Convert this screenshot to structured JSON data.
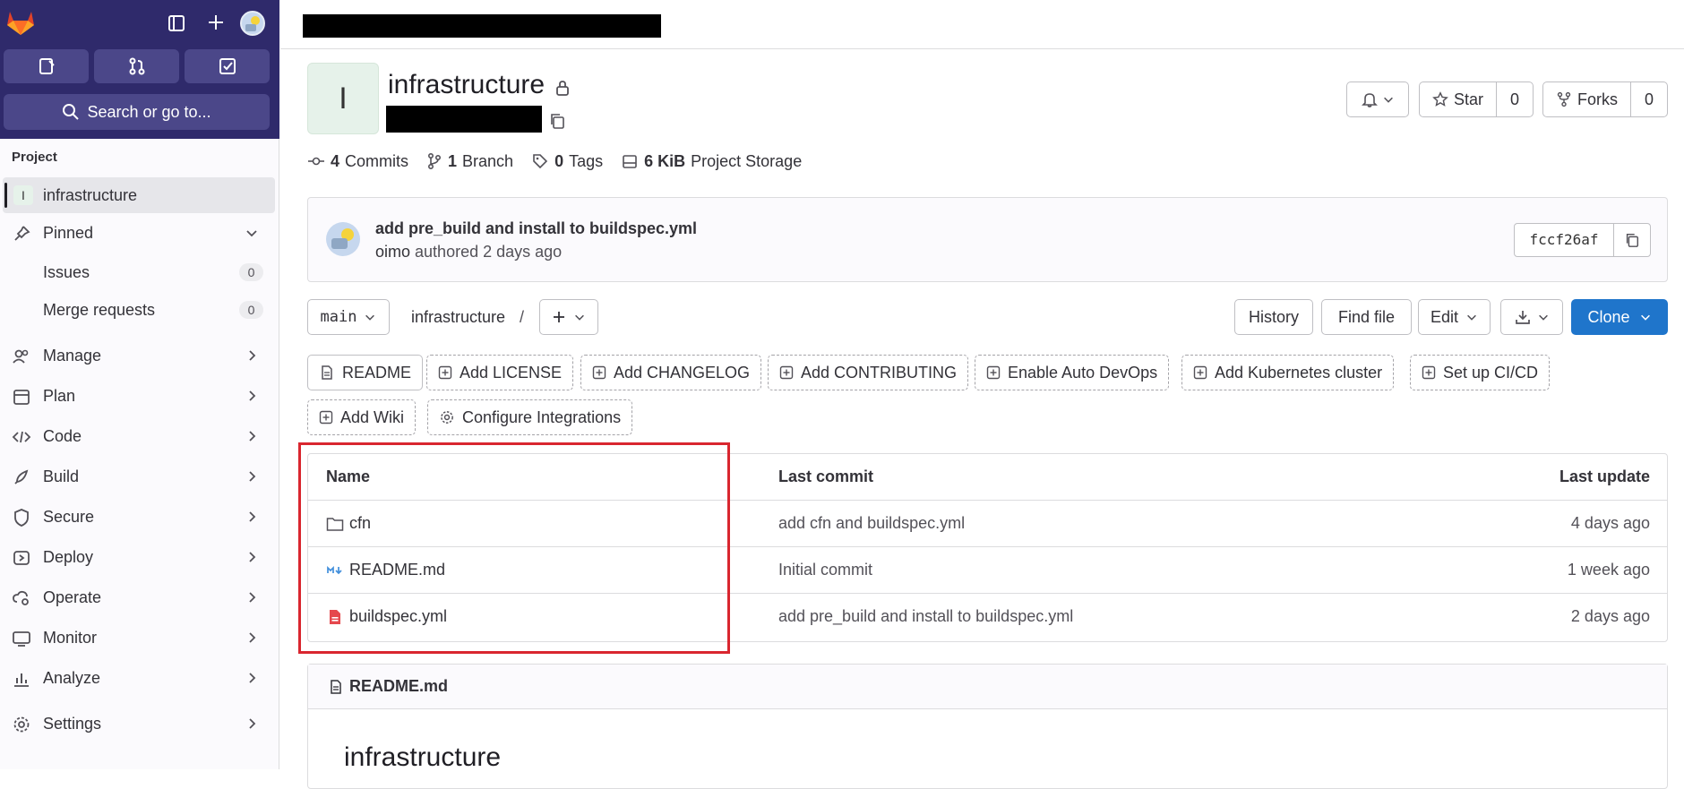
{
  "colors": {
    "sidebar_top": "#2f2a6b",
    "tile": "#4b4789",
    "primary": "#1f75cb",
    "highlight": "#d9262f"
  },
  "sidebar": {
    "search_label": "Search or go to...",
    "section_label": "Project",
    "project": {
      "avatar_letter": "I",
      "name": "infrastructure"
    },
    "pinned": {
      "label": "Pinned",
      "items": [
        {
          "label": "Issues",
          "count": "0"
        },
        {
          "label": "Merge requests",
          "count": "0"
        }
      ]
    },
    "nav": [
      {
        "label": "Manage",
        "icon": "users-icon"
      },
      {
        "label": "Plan",
        "icon": "calendar-icon"
      },
      {
        "label": "Code",
        "icon": "code-icon"
      },
      {
        "label": "Build",
        "icon": "rocket-icon"
      },
      {
        "label": "Secure",
        "icon": "shield-icon"
      },
      {
        "label": "Deploy",
        "icon": "deploy-icon"
      },
      {
        "label": "Operate",
        "icon": "cloud-gear-icon"
      },
      {
        "label": "Monitor",
        "icon": "monitor-icon"
      },
      {
        "label": "Analyze",
        "icon": "chart-icon"
      },
      {
        "label": "Settings",
        "icon": "gear-icon"
      }
    ]
  },
  "project": {
    "avatar_letter": "I",
    "title": "infrastructure",
    "star_label": "Star",
    "star_count": "0",
    "forks_label": "Forks",
    "forks_count": "0"
  },
  "stats": {
    "commits_count": "4",
    "commits_label": "Commits",
    "branch_count": "1",
    "branch_label": "Branch",
    "tags_count": "0",
    "tags_label": "Tags",
    "storage_size": "6 KiB",
    "storage_label": "Project Storage"
  },
  "last_commit": {
    "title": "add pre_build and install to buildspec.yml",
    "author": "oimo",
    "meta": "authored 2 days ago",
    "sha": "fccf26af"
  },
  "toolbar": {
    "branch": "main",
    "breadcrumb": "infrastructure",
    "separator": "/",
    "history": "History",
    "find_file": "Find file",
    "edit": "Edit",
    "clone": "Clone"
  },
  "quick_actions": [
    "README",
    "Add LICENSE",
    "Add CHANGELOG",
    "Add CONTRIBUTING",
    "Enable Auto DevOps",
    "Add Kubernetes cluster",
    "Set up CI/CD",
    "Add Wiki",
    "Configure Integrations"
  ],
  "files": {
    "headers": {
      "name": "Name",
      "last_commit": "Last commit",
      "last_update": "Last update"
    },
    "rows": [
      {
        "name": "cfn",
        "type": "folder-icon",
        "commit": "add cfn and buildspec.yml",
        "updated": "4 days ago"
      },
      {
        "name": "README.md",
        "type": "markdown-icon",
        "commit": "Initial commit",
        "updated": "1 week ago"
      },
      {
        "name": "buildspec.yml",
        "type": "yaml-file-icon",
        "commit": "add pre_build and install to buildspec.yml",
        "updated": "2 days ago"
      }
    ]
  },
  "readme": {
    "filename": "README.md",
    "heading": "infrastructure"
  }
}
